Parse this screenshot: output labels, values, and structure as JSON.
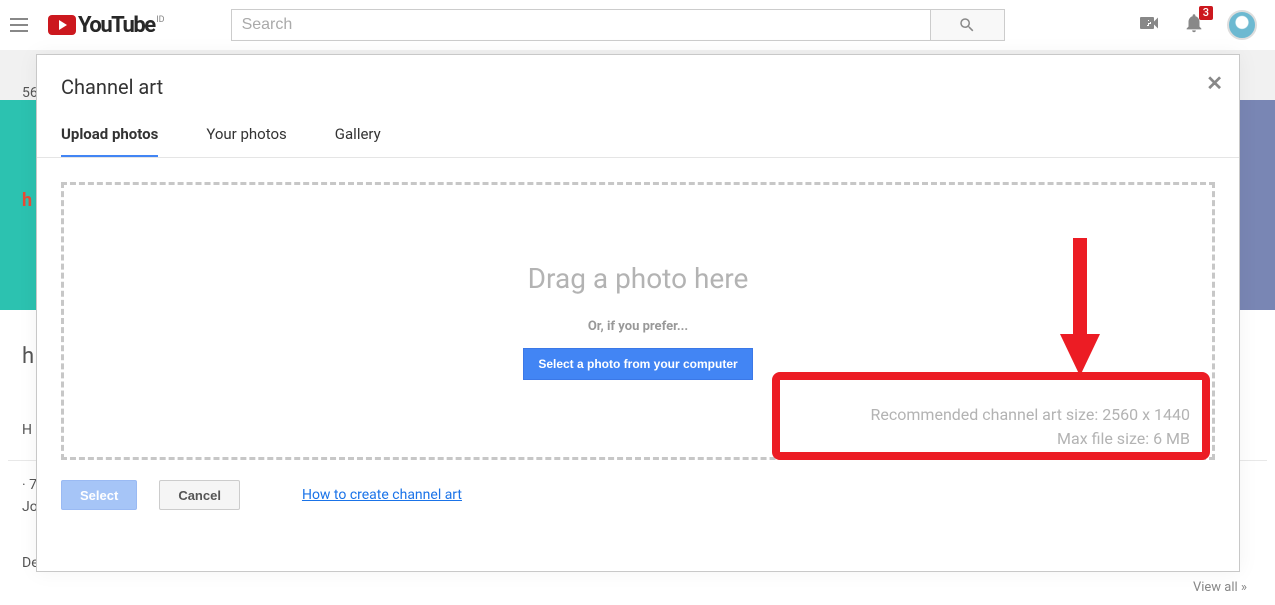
{
  "header": {
    "brand_word": "YouTube",
    "region_sup": "ID",
    "search_placeholder": "Search",
    "notification_count": "3"
  },
  "background": {
    "subheader_text": "56",
    "banner_letter": "h",
    "channel_initial": "h",
    "home_initial": "H",
    "stats_line1": "· 7",
    "stats_line2": "Jo",
    "stats_line3": "De",
    "view_all": "View all  »"
  },
  "modal": {
    "title": "Channel art",
    "tabs": [
      {
        "label": "Upload photos",
        "active": true
      },
      {
        "label": "Your photos",
        "active": false
      },
      {
        "label": "Gallery",
        "active": false
      }
    ],
    "dropzone": {
      "drag_text": "Drag a photo here",
      "or_text": "Or, if you prefer...",
      "pick_button": "Select a photo from your computer",
      "recommended_line": "Recommended channel art size: 2560 x 1440",
      "max_size_line": "Max file size: 6 MB"
    },
    "footer": {
      "select_label": "Select",
      "cancel_label": "Cancel",
      "help_link": "How to create channel art"
    }
  }
}
